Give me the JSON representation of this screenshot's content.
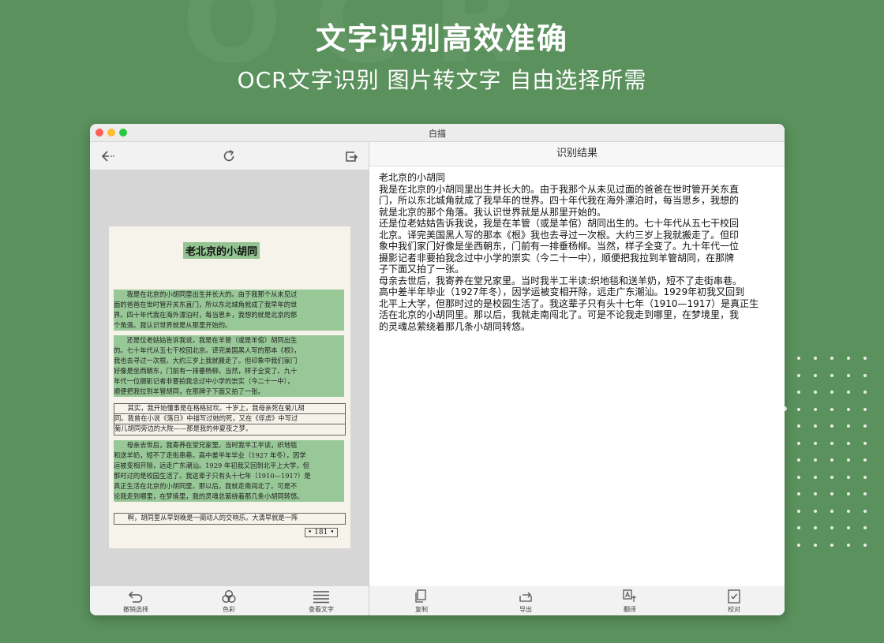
{
  "banner": {
    "headline": "文字识别高效准确",
    "subline": "OCR文字识别 图片转文字 自由选择所需"
  },
  "window": {
    "title": "白描"
  },
  "left_toolbar": {
    "icons": [
      "back-arrow-icon",
      "rotate-icon",
      "export-icon"
    ]
  },
  "document": {
    "title": "老北京的小胡同",
    "lines": [
      {
        "text": "　　我是在北京的小胡同里出生并长大的。由于我那个从未见过",
        "hl": true
      },
      {
        "text": "面的爸爸在世时管开关东直门，所以东北城角就成了我早年的世",
        "hl": true
      },
      {
        "text": "界。四十年代我在海外漂泊时，每当思乡，我想的就是北京的那",
        "hl": true
      },
      {
        "text": "个角落。我认识世界就是从那里开始的。",
        "hl": true
      },
      {
        "text": "　　还是位老姑姑告诉我说，我是在羊管（或是羊倌）胡同出生",
        "hl": true
      },
      {
        "text": "的。七十年代从五七干校回北京。译完美国黑人写的那本《根》，",
        "hl": true
      },
      {
        "text": "我也去寻过一次根。大约三岁上我就搬走了。但印象中我们家门",
        "hl": true
      },
      {
        "text": "好像是坐西朝东，门前有一排垂杨柳。当然，样子全变了。九十",
        "hl": true
      },
      {
        "text": "年代一位摄影记者非要拍我念过中小学的崇实（今二十一中），",
        "hl": true
      },
      {
        "text": "顺便把我拉到羊管胡同，在那牌子下面又拍了一张。",
        "hl": true
      },
      {
        "text": "　　其实，我开始懂事是在格格挝坎。十岁上，我母亲死在菊儿胡",
        "hl": false
      },
      {
        "text": "同。我曾在小说《落日》中描写过她的死，又在《俘虏》中写过",
        "hl": false
      },
      {
        "text": "菊儿胡同旁边的大院——那是我的仲夏夜之梦。",
        "hl": false
      },
      {
        "text": "　　母亲去世后，我寄养在堂兄家里。当时我半工半读，织地毯",
        "hl": true
      },
      {
        "text": "和送羊奶，短不了走街串巷。高中差半年毕业（1927 年冬），因学",
        "hl": true
      },
      {
        "text": "运被变相开除，远走广东潮汕。1929 年初我又回到北平上大学，但",
        "hl": true
      },
      {
        "text": "那时过的是校园生活了。我这辈子只有头十七年（1910—1917）是",
        "hl": true
      },
      {
        "text": "真正生活在北京的小胡同里。那以后，我就走南闯北了。可是不",
        "hl": true
      },
      {
        "text": "论我走到哪里，在梦境里，我的灵魂总萦绕着那几条小胡同转悠。",
        "hl": true
      },
      {
        "text": "　　啊，胡同里从早到晚是一阕动人的交响乐。大清早就是一阵",
        "hl": false
      }
    ],
    "page_number": "• 181 •"
  },
  "left_bottom": [
    {
      "label": "撤销选择",
      "icon": "undo-icon"
    },
    {
      "label": "色彩",
      "icon": "color-circles-icon"
    },
    {
      "label": "查看文字",
      "icon": "text-lines-icon"
    }
  ],
  "right_header": {
    "title": "识别结果"
  },
  "result_lines": [
    "老北京的小胡同",
    "我是在北京的小胡同里出生并长大的。由于我那个从未见过面的爸爸在世时管开关东直",
    "门，所以东北城角就成了我早年的世界。四十年代我在海外漂泊时，每当思乡，我想的",
    "就是北京的那个角落。我认识世界就是从那里开始的。",
    "还是位老姑姑告诉我说，我是在羊管（或是羊倌）胡同出生的。七十年代从五七干校回",
    "北京。译完美国黑人写的那本《根》我也去寻过一次根。大约三岁上我就搬走了。但印",
    "象中我们家门好像是坐西朝东，门前有一排垂杨柳。当然，样子全变了。九十年代一位",
    "摄影记者非要拍我念过中小学的崇实（今二十一中），顺便把我拉到羊管胡同，在那牌",
    "子下面又拍了一张。",
    "母亲去世后，我寄养在堂兄家里。当时我半工半读:织地毯和送羊奶，短不了走街串巷。",
    "高中差半年毕业（1927年冬），因学运被变相开除，远走广东潮汕。1929年初我又回到",
    "北平上大学，但那时过的是校园生活了。我这辈子只有头十七年（1910—1917）是真正生",
    "活在北京的小胡同里。那以后，我就走南闯北了。可是不论我走到哪里，在梦境里，我",
    "的灵魂总萦绕着那几条小胡同转悠。"
  ],
  "right_bottom": [
    {
      "label": "复制",
      "icon": "copy-icon"
    },
    {
      "label": "导出",
      "icon": "share-icon"
    },
    {
      "label": "翻译",
      "icon": "translate-icon"
    },
    {
      "label": "校对",
      "icon": "proofread-icon"
    }
  ],
  "colors": {
    "background": "#5a915c",
    "highlight": "#98c897",
    "panel": "#f2f2f2"
  }
}
